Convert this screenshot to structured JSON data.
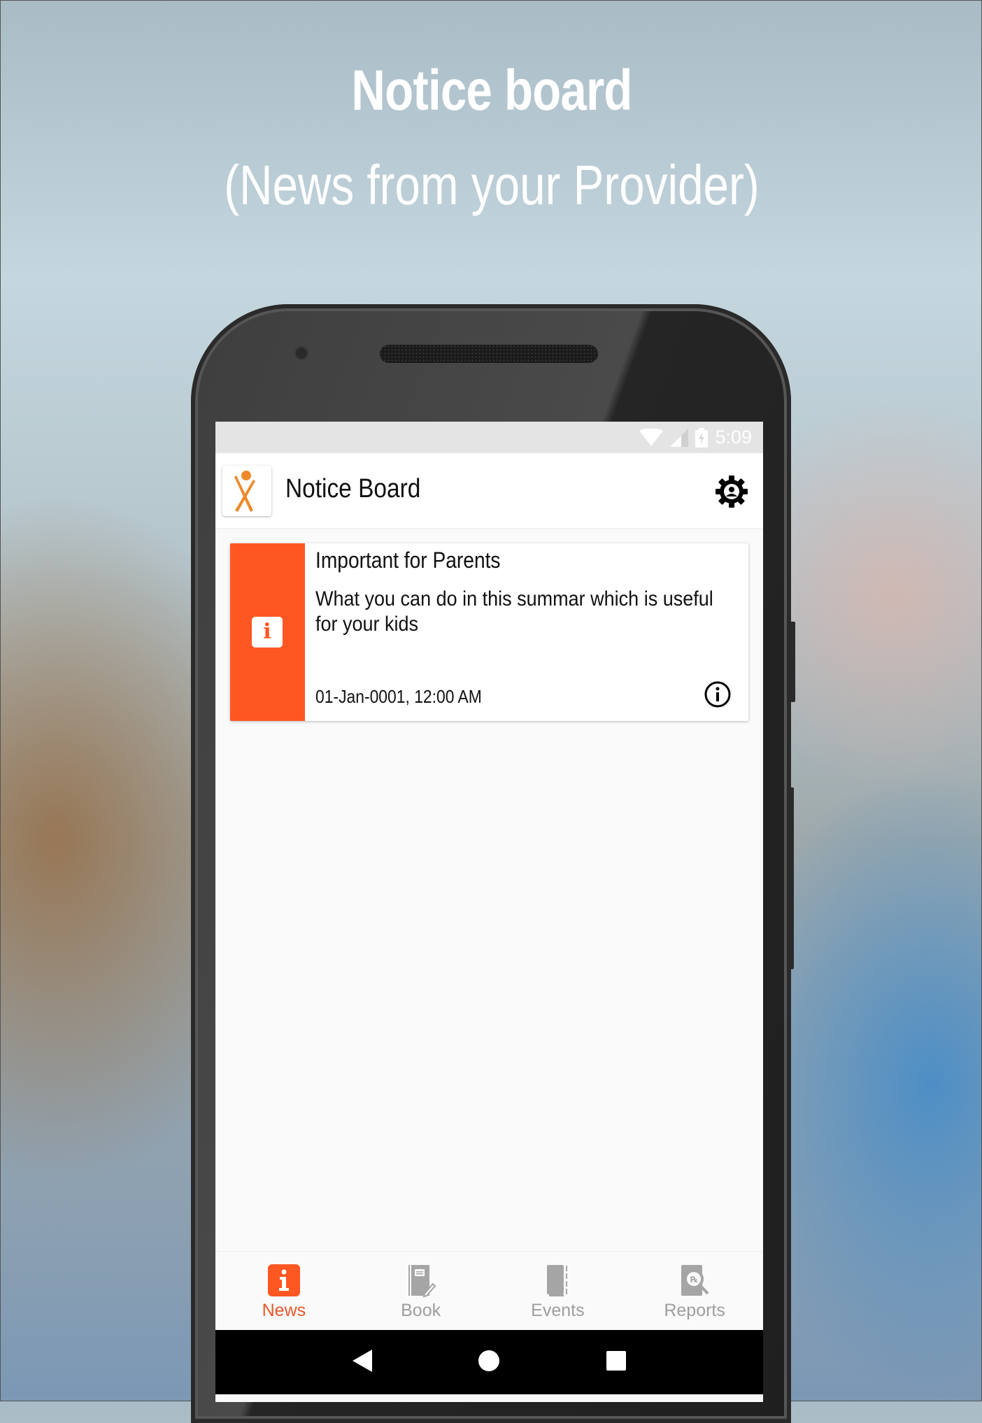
{
  "promo": {
    "title": "Notice board",
    "subtitle": "(News from your Provider)"
  },
  "status_bar": {
    "time": "5:09",
    "icons": [
      "wifi-icon",
      "cell-signal-icon",
      "battery-charging-icon"
    ]
  },
  "app_bar": {
    "title": "Notice Board",
    "logo": "app-logo",
    "action_icon": "settings-icon"
  },
  "notices": [
    {
      "title": "Important for Parents",
      "body": "What you can do in this summar which is useful for your kids",
      "date": "01-Jan-0001, 12:00 AM",
      "type_icon": "info-icon",
      "accent_color": "#ff5722"
    }
  ],
  "bottom_nav": {
    "active": "News",
    "items": [
      {
        "label": "News",
        "icon": "news-info-icon"
      },
      {
        "label": "Book",
        "icon": "book-icon"
      },
      {
        "label": "Events",
        "icon": "events-icon"
      },
      {
        "label": "Reports",
        "icon": "reports-icon"
      }
    ]
  },
  "system_nav": {
    "back": "back",
    "home": "home",
    "recents": "recents"
  },
  "colors": {
    "accent": "#ff5722",
    "active_label": "#e8582a",
    "inactive": "#9e9e9e"
  }
}
